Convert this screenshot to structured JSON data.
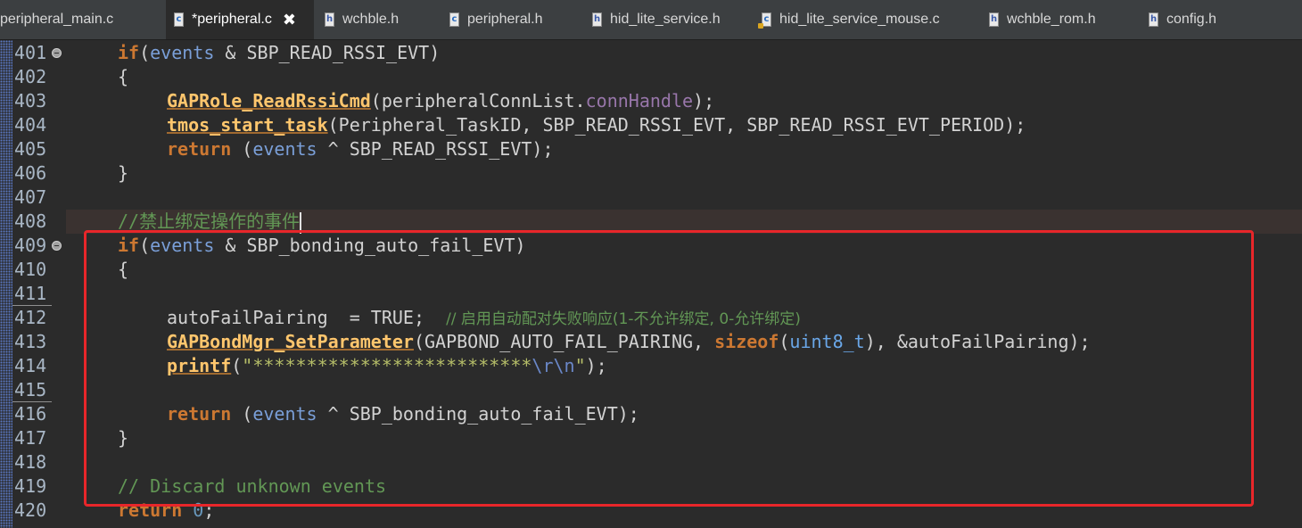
{
  "tabs": [
    {
      "label": "peripheral_main.c",
      "kind": "c",
      "active": false
    },
    {
      "label": "*peripheral.c",
      "kind": "c",
      "active": true
    },
    {
      "label": "wchble.h",
      "kind": "h",
      "active": false
    },
    {
      "label": "peripheral.h",
      "kind": "c",
      "active": false
    },
    {
      "label": "hid_lite_service.h",
      "kind": "h",
      "active": false
    },
    {
      "label": "hid_lite_service_mouse.c",
      "kind": "c",
      "active": false
    },
    {
      "label": "wchble_rom.h",
      "kind": "h",
      "active": false
    },
    {
      "label": "config.h",
      "kind": "h",
      "active": false
    }
  ],
  "close_glyph": "✖",
  "line_numbers": [
    "401",
    "402",
    "403",
    "404",
    "405",
    "406",
    "407",
    "408",
    "409",
    "410",
    "411",
    "412",
    "413",
    "414",
    "415",
    "416",
    "417",
    "418",
    "419",
    "420"
  ],
  "code": {
    "l401": {
      "kw": "if",
      "p1": "(",
      "var": "events",
      "p2": " & SBP_READ_RSSI_EVT)"
    },
    "l402": "{",
    "l403": {
      "fn": "GAPRole_ReadRssiCmd",
      "p1": "(peripheralConnList.",
      "fld": "connHandle",
      "p2": ");"
    },
    "l404": {
      "fn": "tmos_start_task",
      "p1": "(Peripheral_TaskID, SBP_READ_RSSI_EVT, SBP_READ_RSSI_EVT_PERIOD);"
    },
    "l405": {
      "kw": "return",
      "p1": " (",
      "var": "events",
      "p2": " ^ SBP_READ_RSSI_EVT);"
    },
    "l406": "}",
    "l408": {
      "comment": "//禁止绑定操作的事件"
    },
    "l409": {
      "kw": "if",
      "p1": "(",
      "var": "events",
      "p2": " & SBP_bonding_auto_fail_EVT)"
    },
    "l410": "{",
    "l412": {
      "p1": "autoFailPairing  = TRUE;  ",
      "comment": "// 启用自动配对失败响应(1-不允许绑定, 0-允许绑定)"
    },
    "l413": {
      "fn": "GAPBondMgr_SetParameter",
      "p1": "(GAPBOND_AUTO_FAIL_PAIRING, ",
      "kw": "sizeof",
      "p2": "(",
      "type": "uint8_t",
      "p3": "), &autoFailPairing);"
    },
    "l414": {
      "fn": "printf",
      "p1": "(",
      "str": "\"**************************",
      "esc": "\\r\\n",
      "str2": "\"",
      "p2": ");"
    },
    "l416": {
      "kw": "return",
      "p1": " (",
      "var": "events",
      "p2": " ^ SBP_bonding_auto_fail_EVT);"
    },
    "l417": "}",
    "l419": {
      "comment": "// Discard unknown events"
    },
    "l420": {
      "kw": "return",
      "p1": " ",
      "num": "0",
      "p2": ";"
    }
  },
  "colors": {
    "background": "#2b2b2b",
    "keyword": "#cc7832",
    "function": "#ffc66d",
    "comment": "#629755",
    "highlight_box": "#e8262a"
  }
}
